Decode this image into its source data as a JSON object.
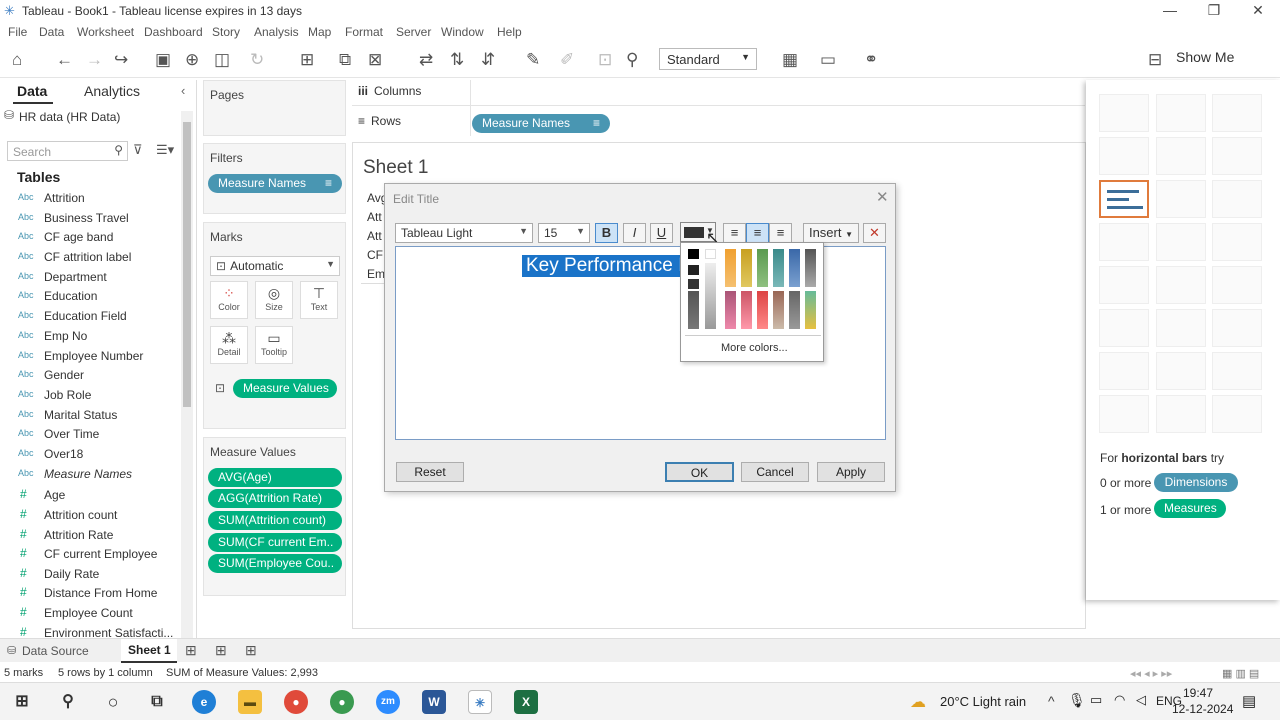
{
  "window": {
    "title": "Tableau - Book1 - Tableau license expires in 13 days"
  },
  "menu": [
    "File",
    "Data",
    "Worksheet",
    "Dashboard",
    "Story",
    "Analysis",
    "Map",
    "Format",
    "Server",
    "Window",
    "Help"
  ],
  "toolbar": {
    "fit_mode": "Standard",
    "show_me": "Show Me"
  },
  "datapane": {
    "tab_data": "Data",
    "tab_analytics": "Analytics",
    "datasource": "HR data (HR Data)",
    "search_placeholder": "Search",
    "tables_header": "Tables",
    "dimensions": [
      "Attrition",
      "Business Travel",
      "CF age band",
      "CF attrition label",
      "Department",
      "Education",
      "Education Field",
      "Emp No",
      "Employee Number",
      "Gender",
      "Job Role",
      "Marital Status",
      "Over Time",
      "Over18"
    ],
    "measure_names_field": "Measure Names",
    "measures": [
      "Age",
      "Attrition count",
      "Attrition Rate",
      "CF current Employee",
      "Daily Rate",
      "Distance From Home",
      "Employee Count",
      "Environment Satisfacti..."
    ],
    "type_abc": "Abc",
    "type_hash": "#"
  },
  "cards": {
    "pages": "Pages",
    "filters": "Filters",
    "filter_pill": "Measure Names",
    "marks": "Marks",
    "mark_type": "Automatic",
    "mark_buttons": [
      "Color",
      "Size",
      "Text",
      "Detail",
      "Tooltip"
    ],
    "marks_pill": "Measure Values",
    "measure_values_header": "Measure Values",
    "measure_values": [
      "AVG(Age)",
      "AGG(Attrition Rate)",
      "SUM(Attrition count)",
      "SUM(CF current Em..",
      "SUM(Employee Cou.."
    ]
  },
  "shelves": {
    "columns": "Columns",
    "rows": "Rows",
    "rows_pill": "Measure Names"
  },
  "sheet": {
    "title": "Sheet 1",
    "rows": [
      "Avg",
      "Att",
      "Att",
      "CF c",
      "Em"
    ]
  },
  "dialog": {
    "title": "Edit Title",
    "font": "Tableau Light",
    "size": "15",
    "bold": "B",
    "italic": "I",
    "underline": "U",
    "insert": "Insert",
    "text": "Key Performance I",
    "more_colors": "More colors...",
    "reset": "Reset",
    "ok": "OK",
    "cancel": "Cancel",
    "apply": "Apply"
  },
  "showme": {
    "hint_prefix": "For ",
    "hint_bold": "horizontal bars",
    "hint_suffix": " try",
    "dim_text": "0 or more",
    "dim_pill": "Dimensions",
    "meas_text": "1 or more",
    "meas_pill": "Measures"
  },
  "tabs": {
    "datasource": "Data Source",
    "sheet1": "Sheet 1"
  },
  "status": {
    "marks": "5 marks",
    "rows": "5 rows by 1 column",
    "sum": "SUM of Measure Values: 2,993"
  },
  "taskbar": {
    "weather": "20°C  Light rain",
    "lang": "ENG",
    "time": "19:47",
    "date": "12-12-2024"
  },
  "colors": {
    "blue_pill": "#4996b2",
    "green_pill": "#00b180",
    "selection": "#1a73c8",
    "showme_selected": "#e07b3c"
  }
}
